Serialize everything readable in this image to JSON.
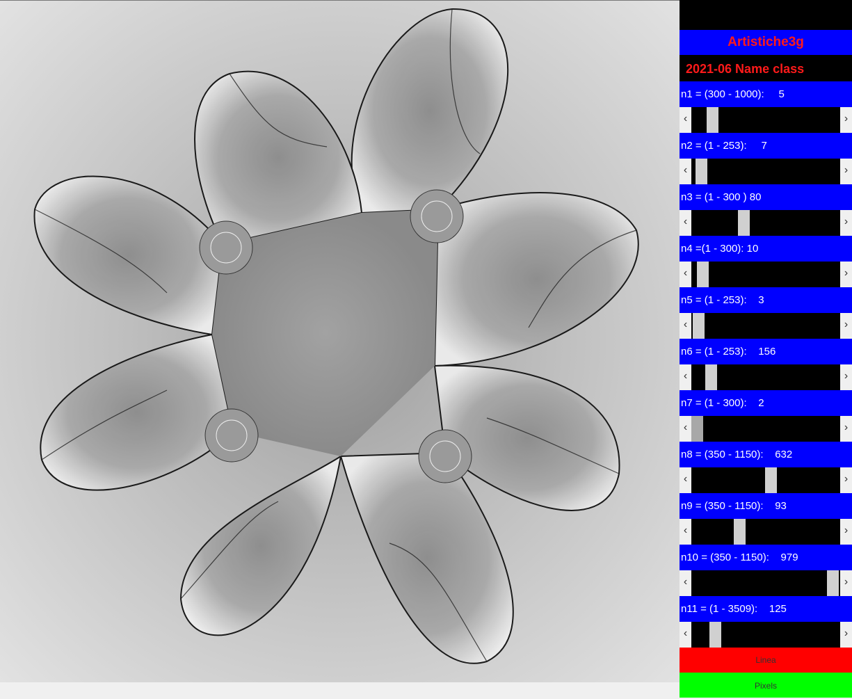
{
  "panel": {
    "title": "Artistiche3g",
    "subtitle": "2021-06  Name class",
    "params": [
      {
        "label": "n1 = (300 - 1000):     5",
        "value": 5,
        "min": 0,
        "max": 100,
        "fraction": 0.11
      },
      {
        "label": "n2 = (1 - 253):     7",
        "value": 7,
        "min": 0,
        "max": 100,
        "fraction": 0.03
      },
      {
        "label": "n3 = (1 - 300 ) 80",
        "value": 80,
        "min": 0,
        "max": 300,
        "fraction": 0.34
      },
      {
        "label": "n4 =(1 - 300): 10",
        "value": 10,
        "min": 0,
        "max": 300,
        "fraction": 0.04
      },
      {
        "label": "n5 = (1 - 253):    3",
        "value": 3,
        "min": 0,
        "max": 253,
        "fraction": 0.01
      },
      {
        "label": "n6 = (1 - 253):    156",
        "value": 156,
        "min": 0,
        "max": 1000,
        "fraction": 0.1
      },
      {
        "label": "n7 = (1 - 300):    2",
        "value": 2,
        "min": 0,
        "max": 300,
        "fraction": 0.0
      },
      {
        "label": "n8 = (350 - 1150):    632",
        "value": 632,
        "min": 0,
        "max": 1150,
        "fraction": 0.54
      },
      {
        "label": "n9 = (350 - 1150):    93",
        "value": 93,
        "min": 0,
        "max": 300,
        "fraction": 0.31
      },
      {
        "label": "n10 = (350 - 1150):    979",
        "value": 979,
        "min": 0,
        "max": 1000,
        "fraction": 0.99
      },
      {
        "label": "n11 = (1 - 3509):    125",
        "value": 125,
        "min": 0,
        "max": 1000,
        "fraction": 0.13
      }
    ],
    "buttons": {
      "linea": "Linea",
      "pixels": "Pixels"
    },
    "arrow_left": "‹",
    "arrow_right": "›"
  },
  "colors": {
    "header_bg": "#0000ff",
    "title_text": "#ff1a1a",
    "linea_bg": "#ff0000",
    "pixels_bg": "#00ff00",
    "track_bg": "#000000",
    "thumb": "#d0d0d0"
  }
}
